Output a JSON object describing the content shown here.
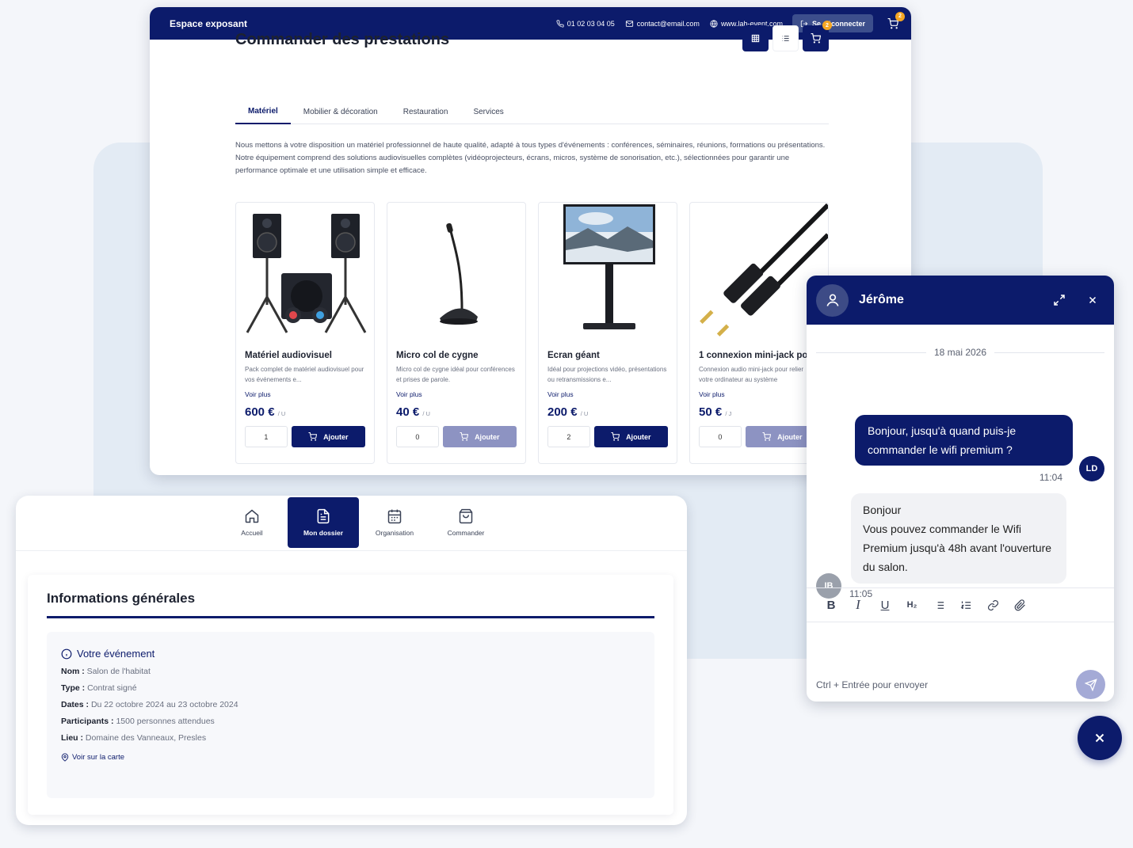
{
  "topbar": {
    "brand": "Espace exposant",
    "phone": "01 02 03 04 05",
    "email": "contact@email.com",
    "website": "www.lab-event.com",
    "logout_label": "Se déconnecter",
    "cart_count": "2"
  },
  "page": {
    "title": "Commander des prestations",
    "cart_count": "2",
    "tabs": [
      {
        "label": "Matériel"
      },
      {
        "label": "Mobilier & décoration"
      },
      {
        "label": "Restauration"
      },
      {
        "label": "Services"
      }
    ],
    "description_1": "Nous mettons à votre disposition un matériel professionnel de haute qualité, adapté à tous types d'événements : conférences, séminaires, réunions, formations ou présentations.",
    "description_2": "Notre équipement comprend des solutions audiovisuelles complètes (vidéoprojecteurs, écrans, micros, système de sonorisation, etc.), sélectionnées pour garantir une performance optimale et une utilisation simple et efficace."
  },
  "products": [
    {
      "name": "Matériel audiovisuel",
      "desc": "Pack complet de matériel audiovisuel pour vos événements e...",
      "more": "Voir plus",
      "price": "600 €",
      "unit": "/ U",
      "qty": "1",
      "add": "Ajouter"
    },
    {
      "name": "Micro col de cygne",
      "desc": "Micro col de cygne idéal pour conférences et prises de parole.",
      "more": "Voir plus",
      "price": "40 €",
      "unit": "/ U",
      "qty": "0",
      "add": "Ajouter"
    },
    {
      "name": "Écran géant",
      "desc": "Idéal pour projections vidéo, présentations ou retransmissions e...",
      "more": "Voir plus",
      "price": "200 €",
      "unit": "/ U",
      "qty": "2",
      "add": "Ajouter"
    },
    {
      "name": "1 connexion mini-jack po",
      "desc": "Connexion audio mini-jack pour relier votre ordinateur au système",
      "more": "Voir plus",
      "price": "50 €",
      "unit": "/ J",
      "qty": "0",
      "add": "Ajouter"
    }
  ],
  "nav": [
    {
      "label": "Accueil"
    },
    {
      "label": "Mon dossier"
    },
    {
      "label": "Organisation"
    },
    {
      "label": "Commander"
    }
  ],
  "info": {
    "title": "Informations générales",
    "event_heading": "Votre événement",
    "fields": [
      {
        "label": "Nom :",
        "value": "Salon de l'habitat"
      },
      {
        "label": "Type :",
        "value": "Contrat signé"
      },
      {
        "label": "Dates :",
        "value": "Du 22 octobre 2024 au 23 octobre 2024"
      },
      {
        "label": "Participants :",
        "value": "1500 personnes attendues"
      },
      {
        "label": "Lieu :",
        "value": "Domaine des Vanneaux, Presles"
      }
    ],
    "map_link": "Voir sur la carte"
  },
  "chat": {
    "contact_name": "Jérôme",
    "date": "18 mai 2026",
    "outgoing": {
      "text": "Bonjour, jusqu'à quand puis-je commander le wifi premium ?",
      "time": "11:04",
      "initials": "LD"
    },
    "incoming": {
      "line1": "Bonjour",
      "line2": "Vous pouvez commander le Wifi Premium jusqu'à 48h avant l'ouverture du salon.",
      "time": "11:05",
      "initials": "IB"
    },
    "toolbar": {
      "bold": "B",
      "italic": "I",
      "underline": "U",
      "heading": "H₂"
    },
    "input_hint": "Ctrl + Entrée pour envoyer"
  },
  "colors": {
    "primary": "#0c1b6b",
    "accent_badge": "#f5a623",
    "disabled_button": "#8d93c2"
  }
}
